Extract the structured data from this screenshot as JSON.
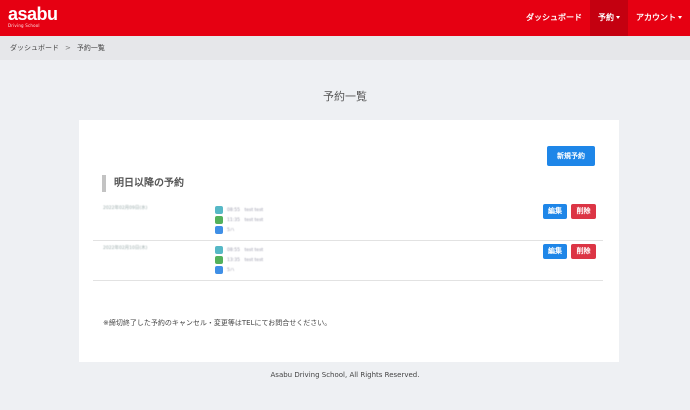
{
  "header": {
    "logo_text": "asabu",
    "logo_sub": "Driving School",
    "nav": [
      {
        "label": "ダッシュボード"
      },
      {
        "label": "予約"
      },
      {
        "label": "アカウント"
      }
    ]
  },
  "breadcrumb": {
    "items": [
      {
        "label": "ダッシュボード"
      },
      {
        "label": "予約一覧"
      }
    ],
    "separator": ">"
  },
  "page": {
    "title": "予約一覧"
  },
  "card": {
    "new_button": "新規予約",
    "section_title": "明日以降の予約",
    "rows": [
      {
        "date": "2022年02月09日(水)",
        "schedule": [
          {
            "icon": "teal-square-icon",
            "text": "08:55　test test"
          },
          {
            "icon": "green-square-icon",
            "text": "11:35　test test"
          },
          {
            "icon": "blue-square-icon",
            "text": "5ハ"
          }
        ],
        "edit_label": "編集",
        "delete_label": "削除"
      },
      {
        "date": "2022年02月10日(木)",
        "schedule": [
          {
            "icon": "teal-square-icon",
            "text": "08:55　test test"
          },
          {
            "icon": "green-square-icon",
            "text": "13:35　test test"
          },
          {
            "icon": "blue-square-icon",
            "text": "5ハ"
          }
        ],
        "edit_label": "編集",
        "delete_label": "削除"
      }
    ],
    "note": "※締切終了した予約のキャンセル・変更等はTELにてお問合せください。"
  },
  "footer": {
    "text": "Asabu Driving School, All Rights Reserved."
  },
  "colors": {
    "brand": "#e60012",
    "primary": "#1e86e8",
    "danger": "#dc3545",
    "background": "#eef0f3"
  }
}
